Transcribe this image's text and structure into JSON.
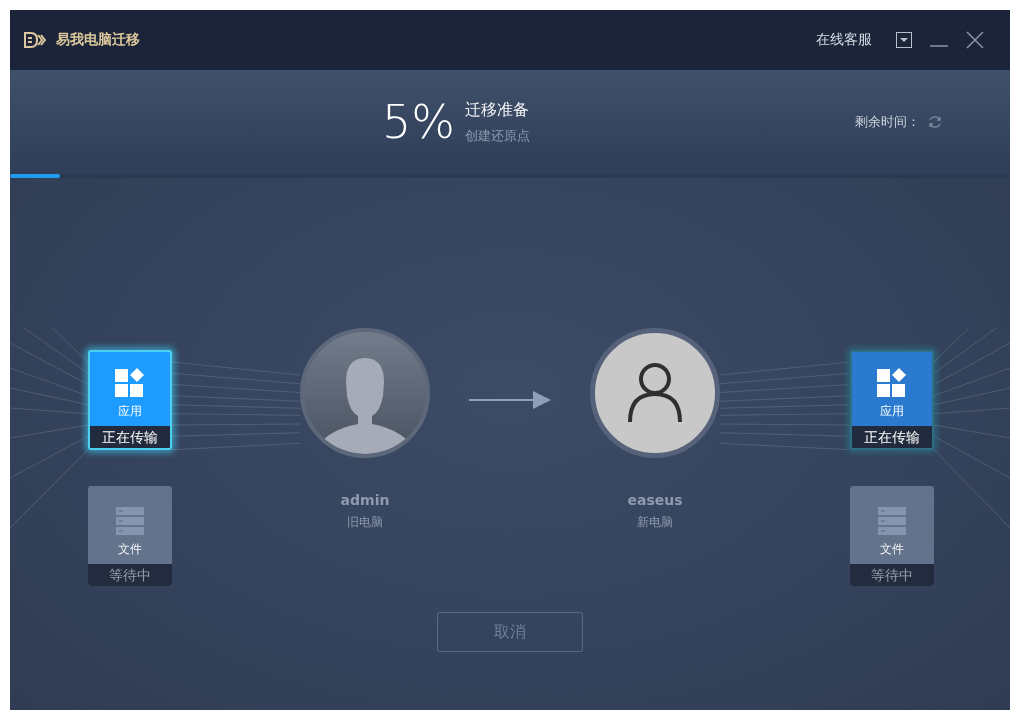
{
  "window": {
    "title": "易我电脑迁移",
    "support_link": "在线客服"
  },
  "progress": {
    "percent": "5%",
    "stage": "迁移准备",
    "step": "创建还原点",
    "remaining_label": "剩余时间：",
    "level": 0.05
  },
  "sides": [
    {
      "computer": {
        "name": "admin",
        "role": "旧电脑",
        "kind": "silhouette"
      },
      "tiles": [
        {
          "kind": "apps",
          "label": "应用",
          "status": "正在传输",
          "active": true
        },
        {
          "kind": "files",
          "label": "文件",
          "status": "等待中",
          "active": false
        }
      ]
    },
    {
      "computer": {
        "name": "easeus",
        "role": "新电脑",
        "kind": "outline"
      },
      "tiles": [
        {
          "kind": "apps",
          "label": "应用",
          "status": "正在传输",
          "active": true
        },
        {
          "kind": "files",
          "label": "文件",
          "status": "等待中",
          "active": false
        }
      ]
    }
  ],
  "cancel_button": {
    "label": "取消",
    "disabled": true
  }
}
